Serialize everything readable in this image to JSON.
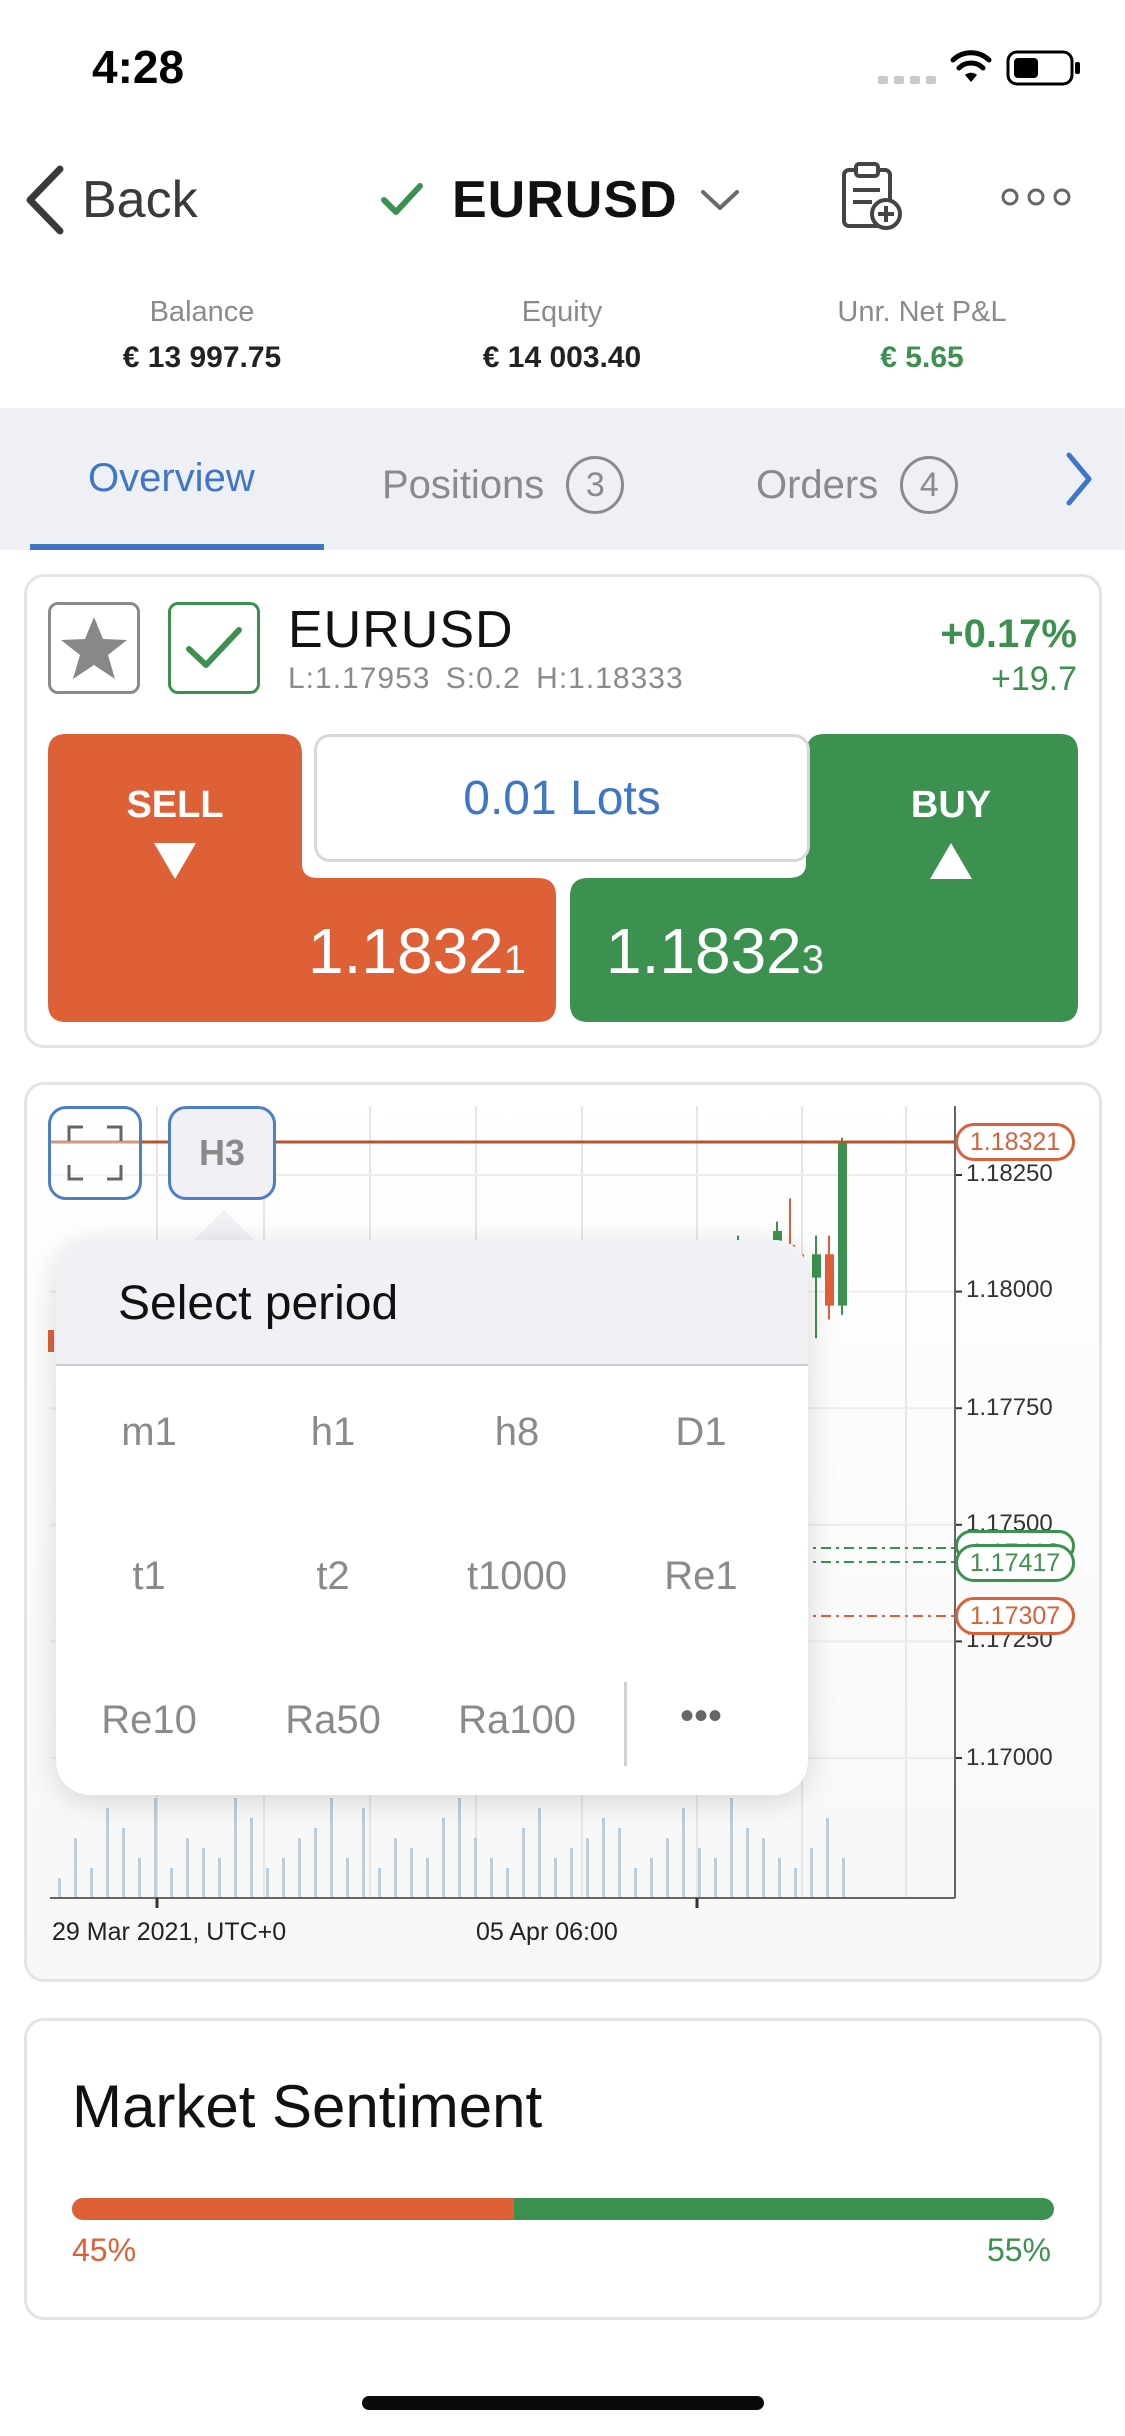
{
  "status_bar": {
    "time": "4:28"
  },
  "nav": {
    "back_label": "Back",
    "title": "EURUSD"
  },
  "account": {
    "balance_label": "Balance",
    "balance_value": "€ 13 997.75",
    "equity_label": "Equity",
    "equity_value": "€ 14 003.40",
    "pnl_label": "Unr. Net P&L",
    "pnl_value": "€ 5.65"
  },
  "tabs": [
    {
      "label": "Overview"
    },
    {
      "label": "Positions",
      "count": "3"
    },
    {
      "label": "Orders",
      "count": "4"
    }
  ],
  "instrument": {
    "symbol": "EURUSD",
    "info": "L:1.17953   S:0.2   H:1.18333",
    "change_pct": "+0.17%",
    "change_pts": "+19.7"
  },
  "trade": {
    "sell_label": "SELL",
    "buy_label": "BUY",
    "lots": "0.01 Lots",
    "sell_price_main": "1.1832",
    "sell_price_sub": "1",
    "buy_price_main": "1.1832",
    "buy_price_sub": "3"
  },
  "chart_controls": {
    "period_button": "H3"
  },
  "chart_data": {
    "type": "candlestick",
    "y_ticks": [
      "1.18250",
      "1.18000",
      "1.17750",
      "1.17500",
      "1.17250",
      "1.17000"
    ],
    "x_ticks": [
      "29 Mar 2021, UTC+0",
      "05 Apr 06:00"
    ],
    "price_lines": [
      {
        "label": "1.18321",
        "color": "#d9603a"
      },
      {
        "label": "1.17417",
        "color": "#3d9150"
      },
      {
        "label": "1.17307",
        "color": "#d9603a"
      }
    ],
    "partial_tag": "1.17413",
    "candles_visible": [
      {
        "o": 1.1802,
        "h": 1.1812,
        "l": 1.18,
        "c": 1.1808,
        "up": true
      },
      {
        "o": 1.1806,
        "h": 1.1808,
        "l": 1.1802,
        "c": 1.1804,
        "up": false
      },
      {
        "o": 1.1803,
        "h": 1.181,
        "l": 1.1801,
        "c": 1.1807,
        "up": true
      },
      {
        "o": 1.1808,
        "h": 1.1815,
        "l": 1.1803,
        "c": 1.1813,
        "up": true
      },
      {
        "o": 1.181,
        "h": 1.182,
        "l": 1.18,
        "c": 1.1804,
        "up": false
      },
      {
        "o": 1.1804,
        "h": 1.1808,
        "l": 1.1798,
        "c": 1.1801,
        "up": false
      },
      {
        "o": 1.1803,
        "h": 1.1812,
        "l": 1.179,
        "c": 1.1808,
        "up": true
      },
      {
        "o": 1.1808,
        "h": 1.1812,
        "l": 1.1794,
        "c": 1.1797,
        "up": false
      },
      {
        "o": 1.1797,
        "h": 1.1833,
        "l": 1.1795,
        "c": 1.1832,
        "up": true
      }
    ]
  },
  "period_popup": {
    "title": "Select period",
    "rows": [
      [
        "m1",
        "h1",
        "h8",
        "D1"
      ],
      [
        "t1",
        "t2",
        "t1000",
        "Re1"
      ],
      [
        "Re10",
        "Ra50",
        "Ra100",
        "•••"
      ]
    ]
  },
  "sentiment": {
    "title": "Market Sentiment",
    "sell_pct_label": "45%",
    "buy_pct_label": "55%",
    "sell_fraction": 0.45
  },
  "colors": {
    "accent": "#3f76c6",
    "sell": "#de6037",
    "buy": "#3d9150"
  },
  "icons": [
    "signal-icon",
    "wifi-icon",
    "battery-icon",
    "chevron-left-icon",
    "check-icon",
    "chevron-down-icon",
    "clipboard-add-icon",
    "more-icon",
    "chevron-right-icon",
    "star-icon",
    "fullscreen-icon"
  ]
}
